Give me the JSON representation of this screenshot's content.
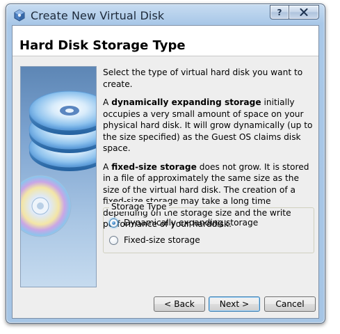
{
  "window": {
    "title": "Create New Virtual Disk",
    "help_label": "?",
    "close_icon": "close-icon"
  },
  "header": {
    "title": "Hard Disk Storage Type"
  },
  "content": {
    "intro": "Select the type of virtual hard disk you want to create.",
    "dynamic_prefix": "A ",
    "dynamic_bold": "dynamically expanding storage",
    "dynamic_rest": " initially occupies a very small amount of space on your physical hard disk. It will grow dynamically (up to the size specified) as the Guest OS claims disk space.",
    "fixed_prefix": "A ",
    "fixed_bold": "fixed-size storage",
    "fixed_rest": " does not grow. It is stored in a file of approximately the same size as the size of the virtual hard disk. The creation of a fixed-size storage may take a long time depending on the storage size and the write performance of your harddisk."
  },
  "storage_type": {
    "legend": "Storage Type",
    "options": [
      {
        "label": "Dynamically expanding storage",
        "checked": true
      },
      {
        "label": "Fixed-size storage",
        "checked": false
      }
    ]
  },
  "buttons": {
    "back": "< Back",
    "next": "Next >",
    "cancel": "Cancel"
  },
  "colors": {
    "accent": "#3c7fb1",
    "frame": "#a9c8e8"
  }
}
